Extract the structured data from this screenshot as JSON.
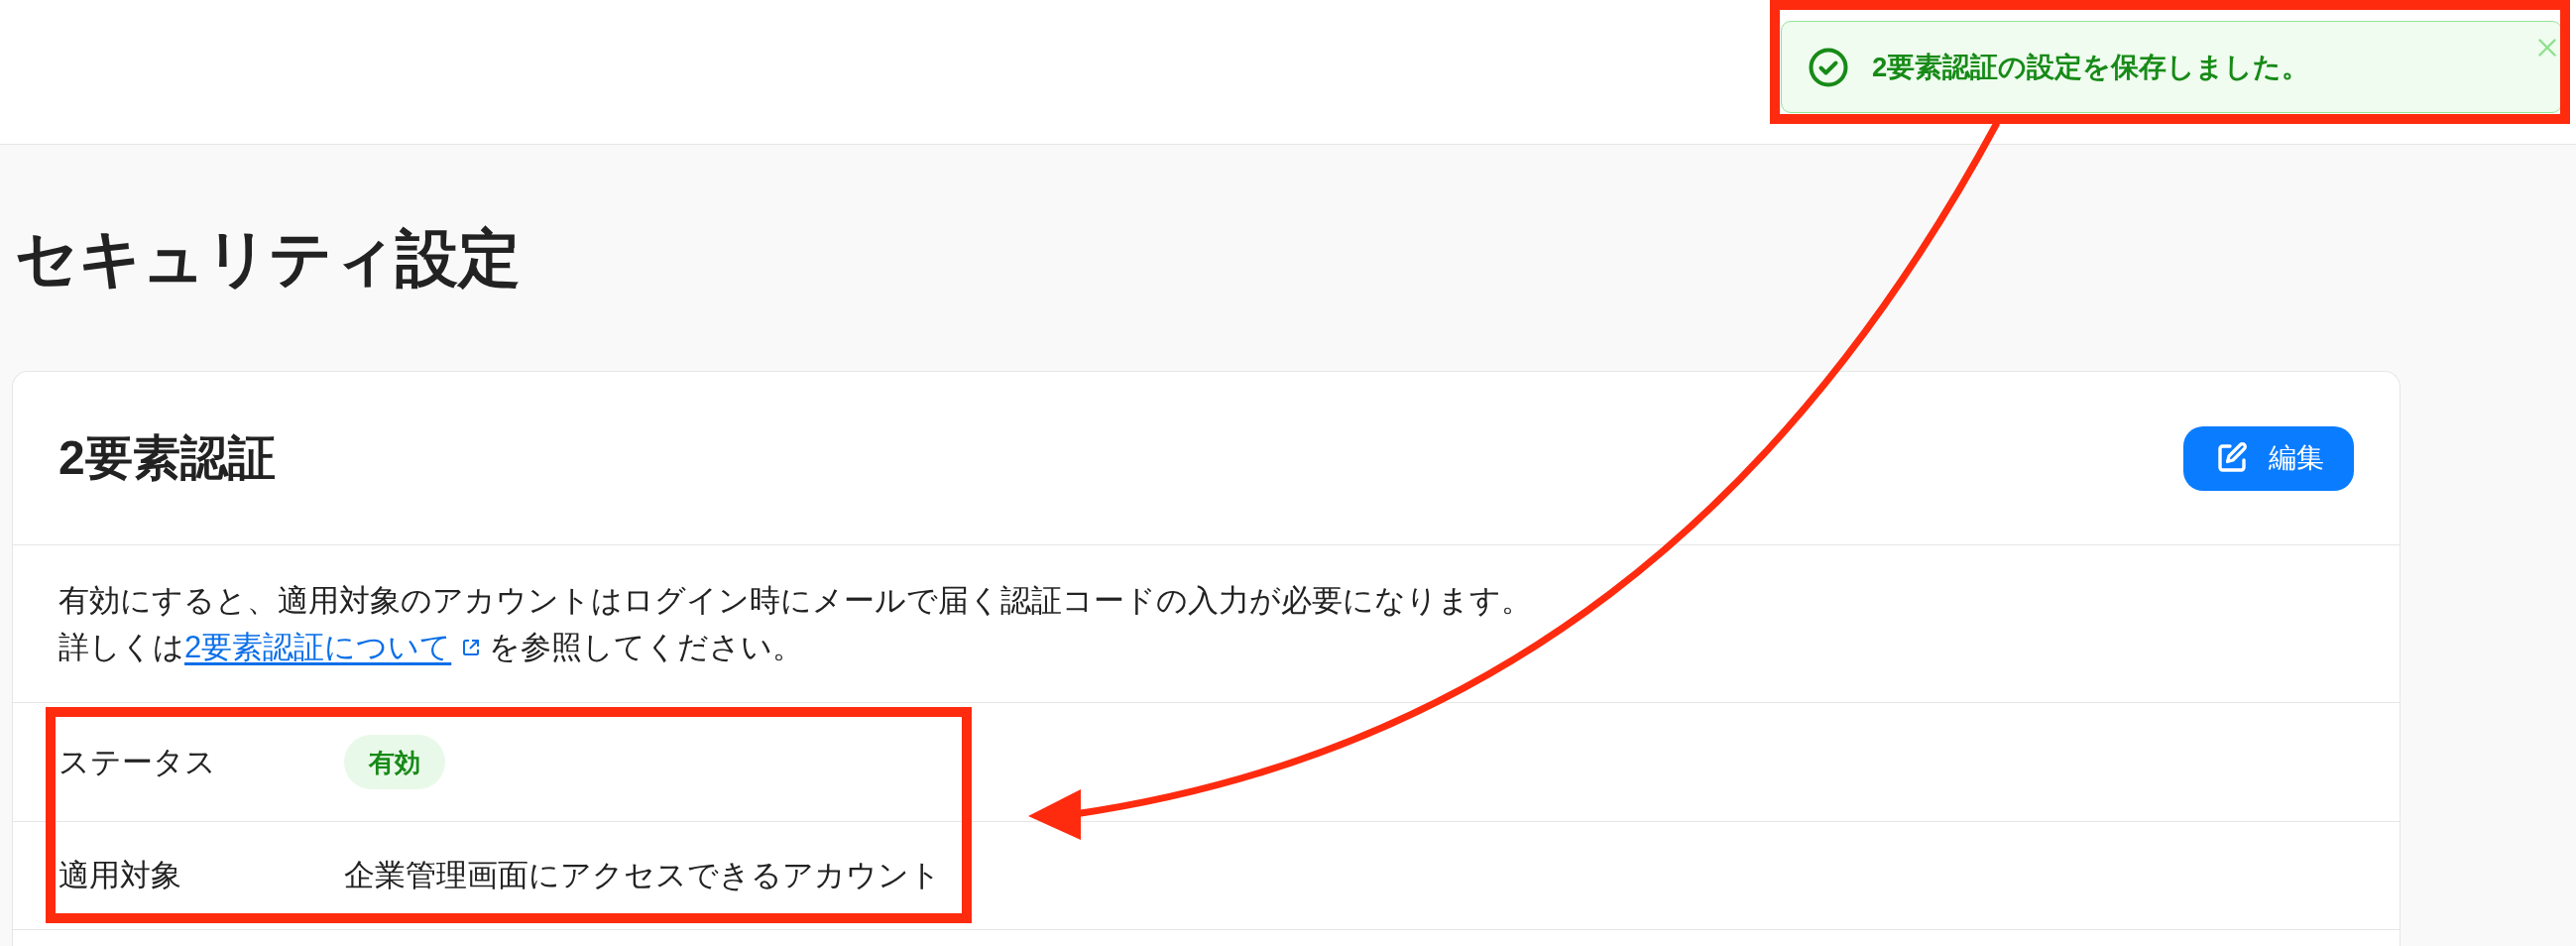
{
  "toast": {
    "kind": "success",
    "message": "2要素認証の設定を保存しました。"
  },
  "page": {
    "title": "セキュリティ設定"
  },
  "card": {
    "title": "2要素認証",
    "edit_button": "編集",
    "description": {
      "text": "有効にすると、適用対象のアカウントはログイン時にメールで届く認証コードの入力が必要になります。",
      "reference": {
        "before": "詳しくは",
        "link": "2要素認証について",
        "after": "を参照してください。"
      }
    },
    "rows": [
      {
        "label": "ステータス",
        "kind": "badge",
        "value": "有効"
      },
      {
        "label": "適用対象",
        "kind": "text",
        "value": "企業管理画面にアクセスできるアカウント"
      }
    ]
  },
  "annotations": [
    {
      "kind": "box"
    },
    {
      "kind": "box"
    },
    {
      "kind": "arrow"
    }
  ]
}
